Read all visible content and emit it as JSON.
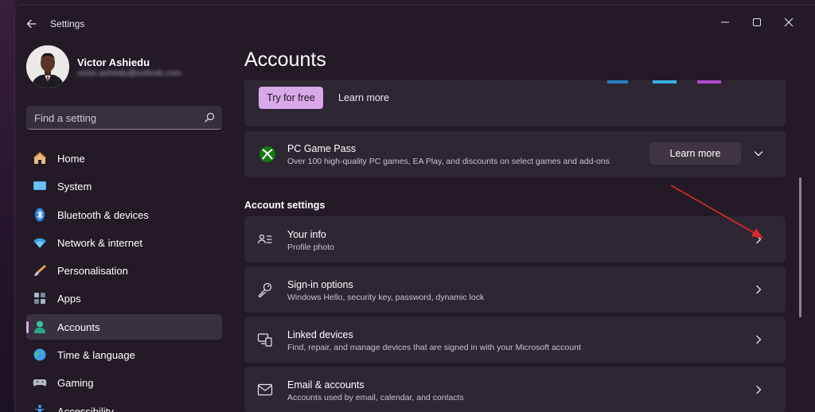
{
  "window": {
    "title": "Settings"
  },
  "profile": {
    "name": "Victor Ashiedu",
    "email": "victor.ashiedu@outlook.com"
  },
  "search": {
    "placeholder": "Find a setting"
  },
  "sidebar": {
    "items": [
      {
        "label": "Home",
        "icon": "home-icon",
        "selected": false
      },
      {
        "label": "System",
        "icon": "monitor-icon",
        "selected": false
      },
      {
        "label": "Bluetooth & devices",
        "icon": "bluetooth-icon",
        "selected": false
      },
      {
        "label": "Network & internet",
        "icon": "wifi-icon",
        "selected": false
      },
      {
        "label": "Personalisation",
        "icon": "brush-icon",
        "selected": false
      },
      {
        "label": "Apps",
        "icon": "apps-icon",
        "selected": false
      },
      {
        "label": "Accounts",
        "icon": "person-icon",
        "selected": true
      },
      {
        "label": "Time & language",
        "icon": "globe-icon",
        "selected": false
      },
      {
        "label": "Gaming",
        "icon": "gamepad-icon",
        "selected": false
      },
      {
        "label": "Accessibility",
        "icon": "accessibility-icon",
        "selected": false
      }
    ]
  },
  "main": {
    "title": "Accounts",
    "promo": {
      "try_label": "Try for free",
      "learn_label": "Learn more"
    },
    "gamepass": {
      "title": "PC Game Pass",
      "subtitle": "Over 100 high-quality PC games, EA Play, and discounts on select games and add-ons",
      "button_label": "Learn more"
    },
    "section_title": "Account settings",
    "settings": [
      {
        "title": "Your info",
        "subtitle": "Profile photo",
        "icon": "contact-card-icon"
      },
      {
        "title": "Sign-in options",
        "subtitle": "Windows Hello, security key, password, dynamic lock",
        "icon": "key-icon"
      },
      {
        "title": "Linked devices",
        "subtitle": "Find, repair, and manage devices that are signed in with your Microsoft account",
        "icon": "devices-icon"
      },
      {
        "title": "Email & accounts",
        "subtitle": "Accounts used by email, calendar, and contacts",
        "icon": "mail-icon"
      }
    ]
  },
  "colors": {
    "accent": "#d8a8e8",
    "window_bg": "#231a26",
    "card_bg": "#2f2633",
    "annotation_arrow": "#d92a2a",
    "xbox_green": "#107c10"
  }
}
